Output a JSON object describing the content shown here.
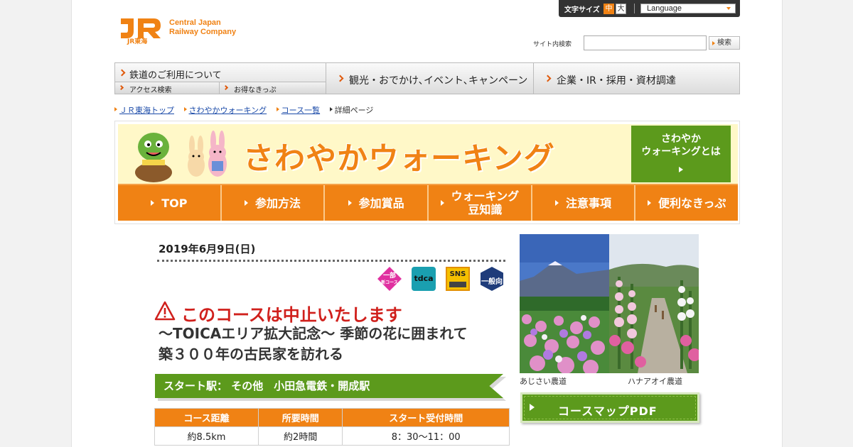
{
  "header": {
    "logo_text_line1": "Central Japan",
    "logo_text_line2": "Railway Company",
    "logo_sub": "JR東海",
    "font_size_label": "文字サイズ",
    "font_size_medium": "中",
    "font_size_large": "大",
    "language_label": "Language",
    "search_label": "サイト内検索",
    "search_value": "",
    "search_button": "検索"
  },
  "global_nav": {
    "item1": "鉄道のご利用について",
    "item1_sub1": "アクセス検索",
    "item1_sub2": "お得なきっぷ",
    "item2": "観光・おでかけ､イベント､キャンペーン",
    "item3": "企業・IR・採用・資材調達"
  },
  "breadcrumb": {
    "items": [
      "ＪＲ東海トップ",
      "さわやかウォーキング",
      "コース一覧",
      "詳細ページ"
    ]
  },
  "banner": {
    "title": "さわやかウォーキング",
    "about_line1": "さわやか",
    "about_line2": "ウォーキングとは",
    "menu": [
      "TOP",
      "参加方法",
      "参加賞品",
      "ウォーキング",
      "豆知識",
      "注意事項",
      "便利なきっぷ"
    ]
  },
  "course": {
    "date": "2019年6月9日(日)",
    "icons": {
      "partial_line1": "一部",
      "partial_line2": "新コース",
      "toica": "tdca",
      "sns": "SNS",
      "general_line1": "一般向"
    },
    "cancel_notice": "このコースは中止いたします",
    "title_line1": "～TOICAエリア拡大記念～ 季節の花に囲まれて",
    "title_line2": "築３００年の古民家を訪れる",
    "start_label": "スタート駅：",
    "start_value": "その他　小田急電鉄・開成駅",
    "table_headers": [
      "コース距離",
      "所要時間",
      "スタート受付時間"
    ],
    "table_values": [
      "約8.5km",
      "約2時間",
      "8：30～11：00"
    ]
  },
  "photos": {
    "caption1": "あじさい農道",
    "caption2": "ハナアオイ農道"
  },
  "pdf_button": "コースマップPDF",
  "colors": {
    "brand_orange": "#f08214",
    "green": "#5c9a1c",
    "alert_red": "#d0201c",
    "link_blue": "#1a4aa8"
  }
}
